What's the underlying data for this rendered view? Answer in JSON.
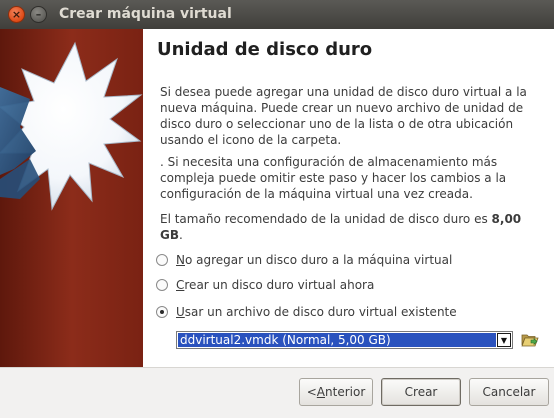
{
  "window": {
    "title": "Crear máquina virtual"
  },
  "page": {
    "title": "Unidad de disco duro",
    "para1": "Si desea puede agregar una unidad de disco duro virtual a la nueva máquina. Puede crear un nuevo archivo de unidad de disco duro o seleccionar uno de la lista o de otra ubicación usando el icono de la carpeta.",
    "para2": ". Si necesita una configuración de almacenamiento más compleja puede omitir este paso y hacer los cambios a la configuración de la máquina virtual una vez creada.",
    "para3_prefix": "El tamaño recomendado de la unidad de disco duro es ",
    "para3_size": "8,00 GB",
    "para3_suffix": "."
  },
  "options": [
    {
      "mnemonic": "N",
      "rest": "o agregar un disco duro a la máquina virtual",
      "checked": false
    },
    {
      "mnemonic": "C",
      "rest": "rear un disco duro virtual ahora",
      "checked": false
    },
    {
      "mnemonic": "U",
      "rest": "sar un archivo de disco duro virtual existente",
      "checked": true
    }
  ],
  "disk_selector": {
    "value": "ddvirtual2.vmdk (Normal, 5,00 GB)"
  },
  "buttons": {
    "back_prefix": "< ",
    "back_mnemonic": "A",
    "back_rest": "nterior",
    "create": "Crear",
    "cancel": "Cancelar"
  },
  "icons": {
    "close": "close-icon",
    "minimize": "minimize-icon",
    "folder": "folder-open-icon",
    "dropdown": "chevron-down-icon"
  },
  "colors": {
    "titlebar": "#4a4945",
    "side_panel": "#7b2314",
    "selection": "#2a52be",
    "close_button": "#df4a16"
  }
}
